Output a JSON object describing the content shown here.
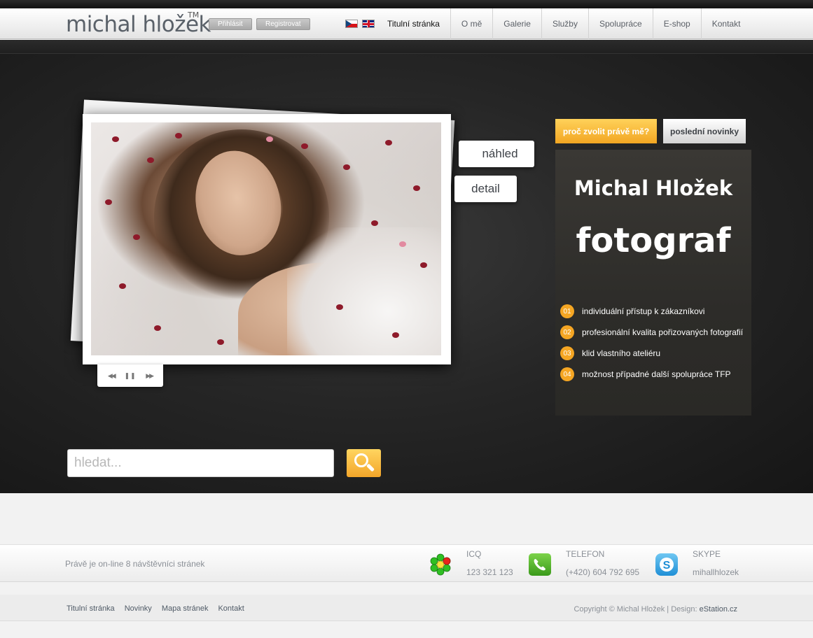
{
  "header": {
    "logo": "michal hložek",
    "logo_tm": "TM",
    "login_label": "Přihlásit",
    "register_label": "Registrovat"
  },
  "nav": {
    "items": [
      {
        "label": "Titulní stránka"
      },
      {
        "label": "O mě"
      },
      {
        "label": "Galerie"
      },
      {
        "label": "Služby"
      },
      {
        "label": "Spolupráce"
      },
      {
        "label": "E-shop"
      },
      {
        "label": "Kontakt"
      }
    ],
    "active_index": 0
  },
  "slideshow": {
    "preview_label": "náhled",
    "detail_label": "detail",
    "controls": [
      "previous-icon",
      "pause-icon",
      "next-icon"
    ]
  },
  "panel": {
    "tab_why": "proč zvolit právě mě?",
    "tab_news": "poslední novinky",
    "name": "Michal Hložek",
    "role": "fotograf",
    "features": [
      {
        "num": "01",
        "text": "individuální přístup k zákazníkovi"
      },
      {
        "num": "02",
        "text": "profesionální kvalita pořizovaných fotografií"
      },
      {
        "num": "03",
        "text": "klid vlastního ateliéru"
      },
      {
        "num": "04",
        "text": "možnost případné další spolupráce TFP"
      }
    ]
  },
  "search": {
    "placeholder": "hledat..."
  },
  "contact_bar": {
    "online_text": "Právě je on-line 8 návštěvníci stránek",
    "icq_label": "ICQ",
    "icq_value": "123 321 123",
    "phone_label": "TELEFON",
    "phone_value": "(+420) 604 792 695",
    "skype_label": "SKYPE",
    "skype_value": "mihallhlozek"
  },
  "footer": {
    "links": [
      "Titulní stránka",
      "Novinky",
      "Mapa stránek",
      "Kontakt"
    ],
    "copyright": "Copyright © Michal Hložek | Design: ",
    "design_link": "eStation.cz"
  },
  "colors": {
    "accent": "#f5a623",
    "dark_bg": "#262626"
  }
}
